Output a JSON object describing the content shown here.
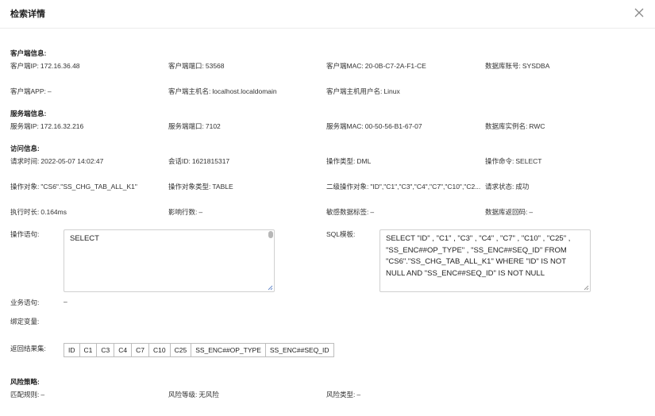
{
  "dialog": {
    "title": "检索详情"
  },
  "client": {
    "title": "客户端信息:",
    "ip_label": "客户端IP:",
    "ip": "172.16.36.48",
    "port_label": "客户端端口:",
    "port": "53568",
    "mac_label": "客户端MAC:",
    "mac": "20-0B-C7-2A-F1-CE",
    "dbacct_label": "数据库账号:",
    "dbacct": "SYSDBA",
    "app_label": "客户端APP:",
    "app": "–",
    "host_label": "客户端主机名:",
    "host": "localhost.localdomain",
    "user_label": "客户端主机用户名:",
    "user": "Linux"
  },
  "server": {
    "title": "服务端信息:",
    "ip_label": "服务端IP:",
    "ip": "172.16.32.216",
    "port_label": "服务端端口:",
    "port": "7102",
    "mac_label": "服务端MAC:",
    "mac": "00-50-56-B1-67-07",
    "instance_label": "数据库实例名:",
    "instance": "RWC"
  },
  "access": {
    "title": "访问信息:",
    "time_label": "请求时间:",
    "time": "2022-05-07 14:02:47",
    "session_label": "会话ID:",
    "session": "1621815317",
    "optype_label": "操作类型:",
    "optype": "DML",
    "cmd_label": "操作命令:",
    "cmd": "SELECT",
    "obj_label": "操作对象:",
    "obj": "\"CS6\".\"SS_CHG_TAB_ALL_K1\"",
    "objtype_label": "操作对象类型:",
    "objtype": "TABLE",
    "obj2_label": "二级操作对象:",
    "obj2": "\"ID\",\"C1\",\"C3\",\"C4\",\"C7\",\"C10\",\"C2...",
    "status_label": "请求状态:",
    "status": "成功",
    "duration_label": "执行时长:",
    "duration": "0.164ms",
    "rows_label": "影响行数:",
    "rows": "–",
    "tag_label": "敏感数据标签:",
    "tag": "–",
    "retcode_label": "数据库返回码:",
    "retcode": "–",
    "stmt_label": "操作语句:",
    "stmt": "SELECT",
    "sqltpl_label": "SQL模板:",
    "sqltpl": "SELECT \"ID\" , \"C1\" , \"C3\" , \"C4\" , \"C7\" , \"C10\" , \"C25\" , \"SS_ENC##OP_TYPE\" , \"SS_ENC##SEQ_ID\" FROM \"CS6\".\"SS_CHG_TAB_ALL_K1\" WHERE \"ID\" IS NOT NULL AND \"SS_ENC##SEQ_ID\" IS NOT NULL",
    "biz_label": "业务语句:",
    "biz": "–",
    "bind_label": "绑定变量:",
    "result_label": "返回结果集:",
    "result_cols": [
      "ID",
      "C1",
      "C3",
      "C4",
      "C7",
      "C10",
      "C25",
      "SS_ENC##OP_TYPE",
      "SS_ENC##SEQ_ID"
    ]
  },
  "risk": {
    "title": "风险策略:",
    "rule_label": "匹配规则:",
    "rule": "–",
    "level_label": "风险等级:",
    "level": "无风险",
    "type_label": "风险类型:",
    "type": "–"
  }
}
